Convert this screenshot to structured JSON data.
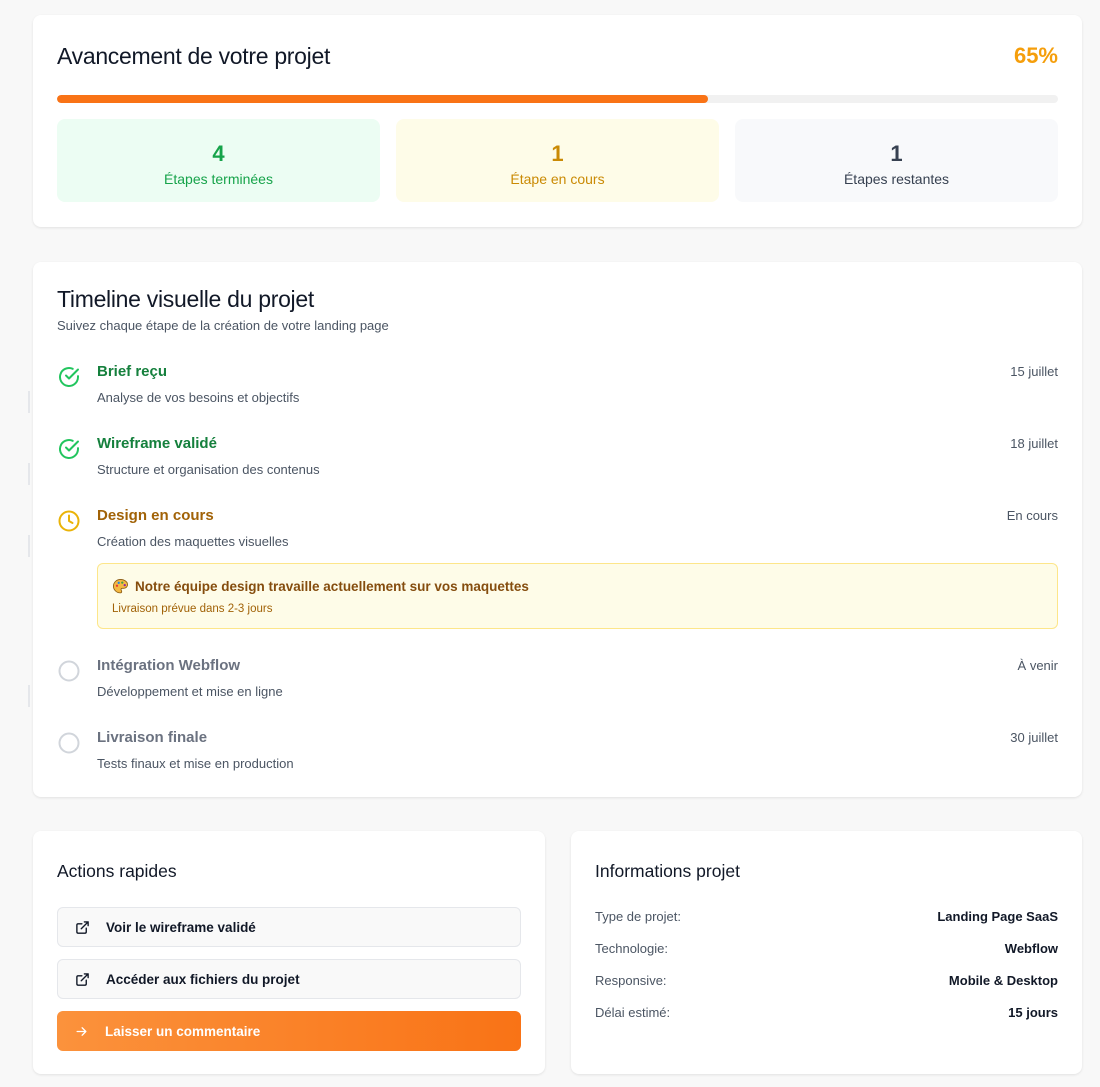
{
  "progress": {
    "title": "Avancement de votre projet",
    "percent_label": "65%",
    "percent_value": 0.65,
    "accent": "#f97316",
    "stats": [
      {
        "value": "4",
        "label": "Étapes terminées"
      },
      {
        "value": "1",
        "label": "Étape en cours"
      },
      {
        "value": "1",
        "label": "Étapes restantes"
      }
    ]
  },
  "timeline": {
    "title": "Timeline visuelle du projet",
    "subtitle": "Suivez chaque étape de la création de votre landing page",
    "steps": [
      {
        "name": "Brief reçu",
        "description": "Analyse de vos besoins et objectifs",
        "date": "15 juillet",
        "status": "done",
        "icon": "check-circle-icon"
      },
      {
        "name": "Wireframe validé",
        "description": "Structure et organisation des contenus",
        "date": "18 juillet",
        "status": "done",
        "icon": "check-circle-icon"
      },
      {
        "name": "Design en cours",
        "description": "Création des maquettes visuelles",
        "date": "En cours",
        "status": "current",
        "icon": "clock-icon"
      },
      {
        "name": "Intégration Webflow",
        "description": "Développement et mise en ligne",
        "date": "À venir",
        "status": "todo",
        "icon": "empty-circle-icon"
      },
      {
        "name": "Livraison finale",
        "description": "Tests finaux et mise en production",
        "date": "30 juillet",
        "status": "todo",
        "icon": "empty-circle-icon"
      }
    ],
    "notice": {
      "icon": "palette-icon",
      "title": "Notre équipe design travaille actuellement sur vos maquettes",
      "subtitle": "Livraison prévue dans 2-3 jours"
    }
  },
  "actions": {
    "title": "Actions rapides",
    "buttons": [
      {
        "label": "Voir le wireframe validé",
        "icon": "external-link-icon"
      },
      {
        "label": "Accéder aux fichiers du projet",
        "icon": "external-link-icon"
      },
      {
        "label": "Laisser un commentaire",
        "icon": "arrow-right-icon"
      }
    ]
  },
  "info": {
    "title": "Informations projet",
    "rows": [
      {
        "key": "Type de projet:",
        "value": "Landing Page SaaS"
      },
      {
        "key": "Technologie:",
        "value": "Webflow"
      },
      {
        "key": "Responsive:",
        "value": "Mobile & Desktop"
      },
      {
        "key": "Délai estimé:",
        "value": "15 jours"
      }
    ]
  },
  "colors": {
    "done": "#22c55e",
    "current": "#eab308",
    "todo": "#d1d5db",
    "percent": "#f59e0b"
  }
}
